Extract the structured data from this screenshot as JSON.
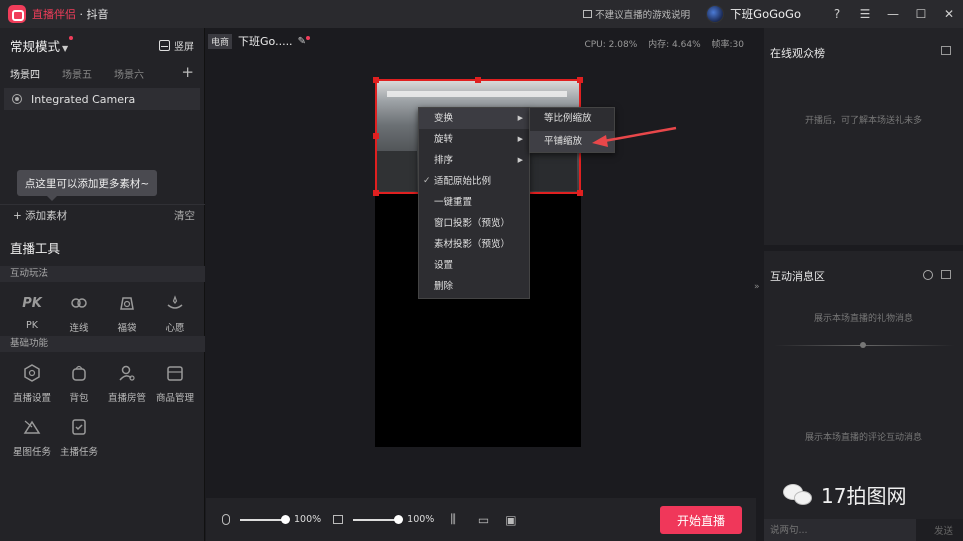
{
  "titlebar": {
    "app_name_brand": "直播伴侣",
    "app_name_rest": " · 抖音",
    "notice": "不建议直播的游戏说明",
    "username": "下班GoGoGo",
    "help_label": "?",
    "menu_label": "☰",
    "min_label": "—",
    "max_label": "☐",
    "close_label": "✕"
  },
  "left": {
    "mode": "常规模式",
    "portrait": "竖屏",
    "scenes": [
      "场景四",
      "场景五",
      "场景六"
    ],
    "source_item": "Integrated Camera",
    "tooltip": "点这里可以添加更多素材~",
    "add_material": "+ 添加素材",
    "clear": "清空",
    "tools_title": "直播工具",
    "section_interactive": "互动玩法",
    "interactive_tools": [
      "PK",
      "连线",
      "福袋",
      "心愿"
    ],
    "section_basic": "基础功能",
    "basic_tools": [
      "直播设置",
      "背包",
      "直播房管",
      "商品管理",
      "星图任务",
      "主播任务"
    ]
  },
  "center": {
    "badge": "电商",
    "room_title": "下班Go.....",
    "cpu": "CPU: 2.08%",
    "mem": "内存: 4.64%",
    "fps": "帧率:30",
    "mic_volume": "100%",
    "speaker_volume": "100%",
    "start_button": "开始直播"
  },
  "context_menu": {
    "items": [
      "变换",
      "旋转",
      "排序",
      "适配原始比例",
      "一键重置",
      "窗口投影（预览）",
      "素材投影（预览）",
      "设置",
      "删除"
    ],
    "submenu": [
      "等比例缩放",
      "平铺缩放"
    ]
  },
  "right": {
    "audience_title": "在线观众榜",
    "audience_empty": "开播后，可了解本场送礼未多",
    "interact_title": "互动消息区",
    "gift_msg": "展示本场直播的礼物消息",
    "comment_msg": "展示本场直播的评论互动消息",
    "chat_placeholder": "说两句...",
    "send": "发送"
  },
  "watermark": "17拍图网",
  "colors": {
    "accent": "#f0375a",
    "selection": "#e02020"
  }
}
